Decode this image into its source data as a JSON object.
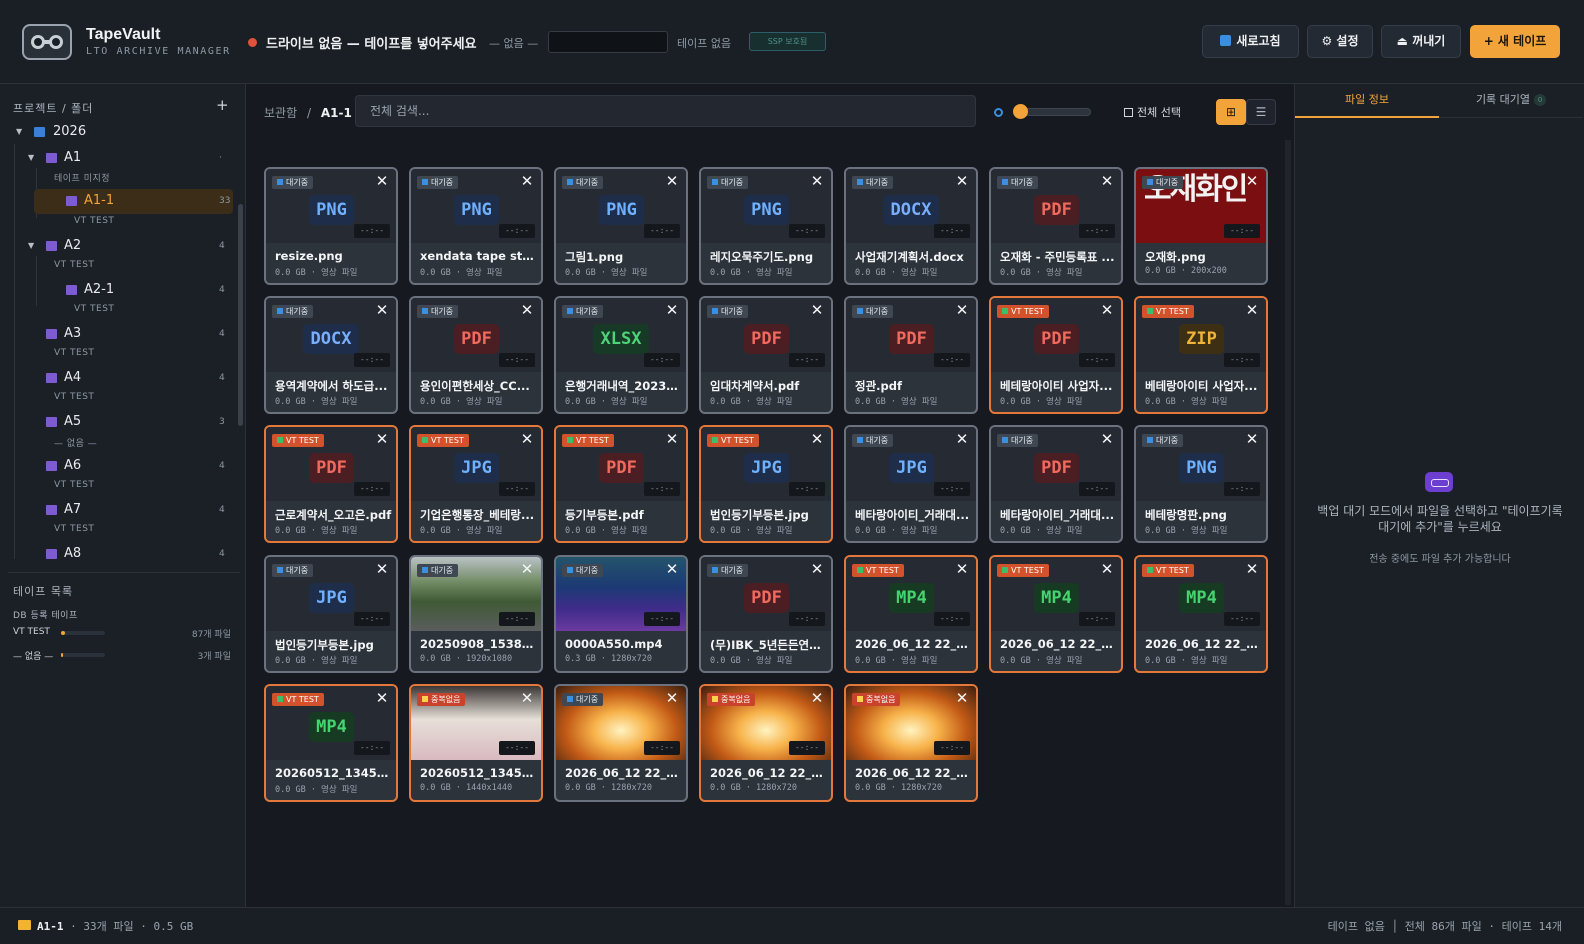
{
  "header": {
    "app_name": "TapeVault",
    "app_sub": "LTO ARCHIVE MANAGER",
    "drive_status": "드라이브 없음 — 테이프를 넣어주세요",
    "drive_label": "— 없음 —",
    "tape_state": "테이프 없음",
    "ssp_label": "SSP 보호됨",
    "refresh": "새로고침",
    "settings": "⚙ 설정",
    "eject": "⏏ 꺼내기",
    "new_tape": "+ 새 테이프",
    "status_dot_color": "#e0523b"
  },
  "sidebar": {
    "title": "프로젝트 / 폴더",
    "add": "+",
    "year": "2026",
    "nodes": [
      {
        "label": "A1",
        "count": "·",
        "sub": "테이프 미지정"
      },
      {
        "label": "A1-1",
        "count": "33",
        "sub": "VT TEST"
      },
      {
        "label": "A2",
        "count": "4",
        "sub": "VT TEST"
      },
      {
        "label": "A2-1",
        "count": "4",
        "sub": "VT TEST"
      },
      {
        "label": "A3",
        "count": "4",
        "sub": "VT TEST"
      },
      {
        "label": "A4",
        "count": "4",
        "sub": "VT TEST"
      },
      {
        "label": "A5",
        "count": "3",
        "sub": "— 없음 —"
      },
      {
        "label": "A6",
        "count": "4",
        "sub": "VT TEST"
      },
      {
        "label": "A7",
        "count": "4",
        "sub": "VT TEST"
      },
      {
        "label": "A8",
        "count": "4",
        "sub": ""
      }
    ],
    "tapes_title": "테이프 목록",
    "db_title": "DB 등록 테이프",
    "tapes": [
      {
        "name": "VT TEST",
        "files": "87개 파일",
        "fill": 0.1
      },
      {
        "name": "— 없음 —",
        "files": "3개 파일",
        "fill": 0.05
      }
    ]
  },
  "toolbar": {
    "crumb_root": "보관함",
    "crumb_sep": "/",
    "crumb_current": "A1-1",
    "search_placeholder": "전체 검색...",
    "zoom": 0.0,
    "select_all": "전체 선택",
    "grid_icon": "⊞",
    "list_icon": "☰"
  },
  "cards": [
    {
      "badge": "대기중",
      "kind": "wait",
      "type": "PNG",
      "name": "resize.png",
      "meta": "0.0 GB · 영상 파일",
      "dur": "--:--"
    },
    {
      "badge": "대기중",
      "kind": "wait",
      "type": "PNG",
      "name": "xendata tape stuck...",
      "meta": "0.0 GB · 영상 파일",
      "dur": "--:--"
    },
    {
      "badge": "대기중",
      "kind": "wait",
      "type": "PNG",
      "name": "그림1.png",
      "meta": "0.0 GB · 영상 파일",
      "dur": "--:--"
    },
    {
      "badge": "대기중",
      "kind": "wait",
      "type": "PNG",
      "name": "레지오묵주기도.png",
      "meta": "0.0 GB · 영상 파일",
      "dur": "--:--"
    },
    {
      "badge": "대기중",
      "kind": "wait",
      "type": "DOCX",
      "name": "사업재기계획서.docx",
      "meta": "0.0 GB · 영상 파일",
      "dur": "--:--"
    },
    {
      "badge": "대기중",
      "kind": "wait",
      "type": "PDF",
      "name": "오재화 - 주민등록표 ...",
      "meta": "0.0 GB · 영상 파일",
      "dur": "--:--"
    },
    {
      "badge": "대기중",
      "kind": "wait",
      "type": "",
      "photo": "seal",
      "seal_text": "오재화인",
      "name": "오재화.png",
      "meta": "0.0 GB · 200x200",
      "dur": "--:--"
    },
    {
      "badge": "대기중",
      "kind": "wait",
      "type": "DOCX",
      "name": "용역계약에서 하도급...",
      "meta": "0.0 GB · 영상 파일",
      "dur": "--:--"
    },
    {
      "badge": "대기중",
      "kind": "wait",
      "type": "PDF",
      "name": "용인이편한세상_CC...",
      "meta": "0.0 GB · 영상 파일",
      "dur": "--:--"
    },
    {
      "badge": "대기중",
      "kind": "wait",
      "type": "XLSX",
      "name": "은행거래내역_20231...",
      "meta": "0.0 GB · 영상 파일",
      "dur": "--:--"
    },
    {
      "badge": "대기중",
      "kind": "wait",
      "type": "PDF",
      "name": "임대차계약서.pdf",
      "meta": "0.0 GB · 영상 파일",
      "dur": "--:--"
    },
    {
      "badge": "대기중",
      "kind": "wait",
      "type": "PDF",
      "name": "정관.pdf",
      "meta": "0.0 GB · 영상 파일",
      "dur": "--:--"
    },
    {
      "badge": "VT TEST",
      "kind": "vt",
      "type": "PDF",
      "name": "베테랑아이티 사업자...",
      "meta": "0.0 GB · 영상 파일",
      "dur": "--:--"
    },
    {
      "badge": "VT TEST",
      "kind": "vt",
      "type": "ZIP",
      "name": "베테랑아이티 사업자...",
      "meta": "0.0 GB · 영상 파일",
      "dur": "--:--"
    },
    {
      "badge": "VT TEST",
      "kind": "vt",
      "type": "PDF",
      "name": "근로계약서_오고은.pdf",
      "meta": "0.0 GB · 영상 파일",
      "dur": "--:--"
    },
    {
      "badge": "VT TEST",
      "kind": "vt",
      "type": "JPG",
      "name": "기업은행통장_베테랑...",
      "meta": "0.0 GB · 영상 파일",
      "dur": "--:--"
    },
    {
      "badge": "VT TEST",
      "kind": "vt",
      "type": "PDF",
      "name": "등기부등본.pdf",
      "meta": "0.0 GB · 영상 파일",
      "dur": "--:--"
    },
    {
      "badge": "VT TEST",
      "kind": "vt",
      "type": "JPG",
      "name": "법인등기부등본.jpg",
      "meta": "0.0 GB · 영상 파일",
      "dur": "--:--"
    },
    {
      "badge": "대기중",
      "kind": "wait",
      "type": "JPG",
      "name": "베타랑아이티_거래대...",
      "meta": "0.0 GB · 영상 파일",
      "dur": "--:--"
    },
    {
      "badge": "대기중",
      "kind": "wait",
      "type": "PDF",
      "name": "베타랑아이티_거래대...",
      "meta": "0.0 GB · 영상 파일",
      "dur": "--:--"
    },
    {
      "badge": "대기중",
      "kind": "wait",
      "type": "PNG",
      "name": "베테랑명판.png",
      "meta": "0.0 GB · 영상 파일",
      "dur": "--:--"
    },
    {
      "badge": "대기중",
      "kind": "wait",
      "type": "JPG",
      "name": "법인등기부등본.jpg",
      "meta": "0.0 GB · 영상 파일",
      "dur": "--:--"
    },
    {
      "badge": "대기중",
      "kind": "wait",
      "type": "",
      "photo": "road",
      "name": "20250908_153848....",
      "meta": "0.0 GB · 1920x1080",
      "dur": "--:--"
    },
    {
      "badge": "대기중",
      "kind": "wait",
      "type": "",
      "photo": "stage",
      "name": "0000A550.mp4",
      "meta": "0.3 GB · 1280x720",
      "dur": "--:--"
    },
    {
      "badge": "대기중",
      "kind": "wait",
      "type": "PDF",
      "name": "(무)IBK_5년든든연금...",
      "meta": "0.0 GB · 영상 파일",
      "dur": "--:--"
    },
    {
      "badge": "VT TEST",
      "kind": "vt",
      "type": "MP4",
      "name": "2026_06_12 22_41 (...",
      "meta": "0.0 GB · 영상 파일",
      "dur": "--:--"
    },
    {
      "badge": "VT TEST",
      "kind": "vt",
      "type": "MP4",
      "name": "2026_06_12 22_41 (...",
      "meta": "0.0 GB · 영상 파일",
      "dur": "--:--"
    },
    {
      "badge": "VT TEST",
      "kind": "vt",
      "type": "MP4",
      "name": "2026_06_12 22_41 (...",
      "meta": "0.0 GB · 영상 파일",
      "dur": "--:--"
    },
    {
      "badge": "VT TEST",
      "kind": "vt",
      "type": "MP4",
      "name": "20260512_134546....",
      "meta": "0.0 GB · 영상 파일",
      "dur": "--:--"
    },
    {
      "badge": "중복없음",
      "kind": "warn",
      "type": "",
      "photo": "desk",
      "name": "20260512_134546....",
      "meta": "0.0 GB · 1440x1440",
      "dur": "--:--"
    },
    {
      "badge": "대기중",
      "kind": "wait",
      "type": "",
      "photo": "fire",
      "name": "2026_06_12 22_41 (...",
      "meta": "0.0 GB · 1280x720",
      "dur": "--:--"
    },
    {
      "badge": "중복없음",
      "kind": "warn",
      "type": "",
      "photo": "fire",
      "name": "2026_06_12 22_41 (...",
      "meta": "0.0 GB · 1280x720",
      "dur": "--:--"
    },
    {
      "badge": "중복없음",
      "kind": "warn",
      "type": "",
      "photo": "fire",
      "name": "2026_06_12 22_41 (...",
      "meta": "0.0 GB · 1280x720",
      "dur": "--:--"
    }
  ],
  "type_colors": {
    "PNG": {
      "fg": "#6fb0ff",
      "bg": "#1d2d4a"
    },
    "JPG": {
      "fg": "#6fb0ff",
      "bg": "#1d2d4a"
    },
    "DOCX": {
      "fg": "#79aefc",
      "bg": "#1d2d4a"
    },
    "PDF": {
      "fg": "#f06a5e",
      "bg": "#4a1e22"
    },
    "XLSX": {
      "fg": "#4fd37a",
      "bg": "#173a26"
    },
    "ZIP": {
      "fg": "#f0b43a",
      "bg": "#3d2f14"
    },
    "MP4": {
      "fg": "#45d46f",
      "bg": "#163a22"
    }
  },
  "right": {
    "tab_info": "파일 정보",
    "tab_queue": "기록 대기열",
    "queue_count": "0",
    "message": "백업 대기 모드에서 파일을 선택하고 \"테이프기록 대기에 추가\"를 누르세요",
    "note": "전송 중에도 파일 추가 가능합니다"
  },
  "status": {
    "folder": "A1-1",
    "summary": "· 33개 파일 · 0.5 GB",
    "right": "테이프 없음 │ 전체 86개 파일 · 테이프 14개"
  },
  "accent": "#f2a33a"
}
